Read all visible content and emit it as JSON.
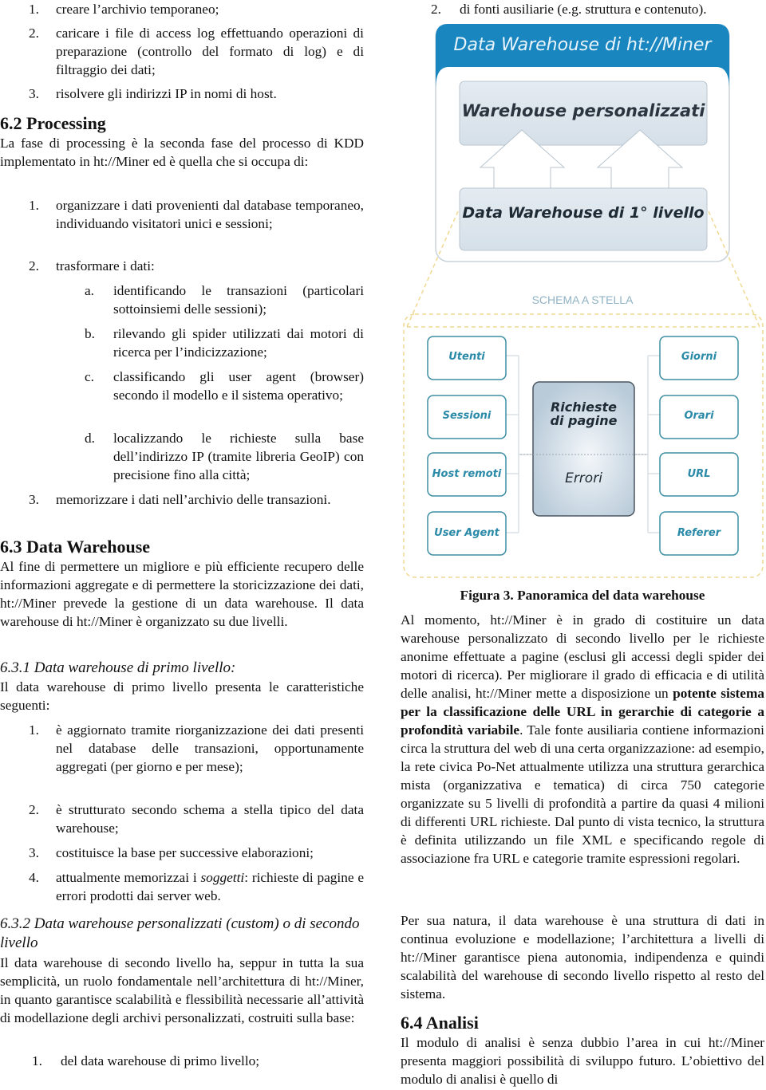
{
  "left_column": {
    "intro_list": [
      {
        "num": "1.",
        "text": "creare l’archivio temporaneo;"
      },
      {
        "num": "2.",
        "text": "caricare i file di access log effettuando operazioni di preparazione (controllo del formato di log) e di filtraggio dei dati;"
      },
      {
        "num": "3.",
        "text": "risolvere gli indirizzi IP in nomi di host."
      }
    ],
    "section_6_2": {
      "heading": "6.2  Processing",
      "paragraph": "La fase di processing è la seconda fase del processo di KDD implementato in ht://Miner ed è quella che si occupa di:",
      "list": [
        {
          "num": "1.",
          "text": "organizzare i dati provenienti dal database temporaneo, individuando visitatori unici e sessioni;"
        },
        {
          "num": "2.",
          "text": "trasformare i dati:"
        },
        {
          "num": "3.",
          "text": "memorizzare i dati nell’archivio delle transazioni."
        }
      ],
      "sublist": [
        {
          "num": "a.",
          "text": "identificando le transazioni (particolari sottoinsiemi delle sessioni);"
        },
        {
          "num": "b.",
          "text": "rilevando gli spider utilizzati dai motori di ricerca per l’indicizzazione;"
        },
        {
          "num": "c.",
          "text": "classificando gli user agent (browser) secondo il modello e il sistema operativo;"
        },
        {
          "num": "d.",
          "text": "localizzando le richieste sulla base dell’indirizzo IP (tramite libreria GeoIP) con precisione fino alla città;"
        }
      ]
    },
    "section_6_3": {
      "heading": "6.3  Data Warehouse",
      "paragraph": "Al fine di permettere un migliore e più efficiente recupero delle informazioni aggregate e di permettere la storicizzazione dei dati, ht://Miner prevede la gestione di un data warehouse. Il data warehouse di ht://Miner è organizzato su due livelli."
    },
    "section_6_3_1": {
      "heading": "6.3.1  Data warehouse di primo livello:",
      "paragraph": "Il data warehouse di primo livello presenta le caratteristiche seguenti:",
      "list": [
        {
          "num": "1.",
          "text": "è aggiornato tramite riorganizzazione dei dati presenti nel database delle transazioni, opportunamente aggregati (per giorno e per mese);"
        },
        {
          "num": "2.",
          "text": "è strutturato secondo schema a stella tipico del data warehouse;"
        },
        {
          "num": "3.",
          "text": "costituisce la base per successive elaborazioni;"
        },
        {
          "num": "4.",
          "text_before": "attualmente memorizzai i ",
          "text_italic": "soggetti",
          "text_after": ": richieste di pagine e errori prodotti dai server web."
        }
      ]
    },
    "section_6_3_2": {
      "heading": "6.3.2  Data warehouse personalizzati (custom) o di secondo livello",
      "paragraph": "Il data warehouse di secondo livello ha, seppur in tutta la sua semplicità, un ruolo fondamentale nell’architettura di ht://Miner, in quanto garantisce scalabilità e flessibilità necessarie all’attività di modellazione degli archivi personalizzati, costruiti sulla base:",
      "list": [
        {
          "num": "1.",
          "text": "del data warehouse di primo livello;"
        }
      ]
    }
  },
  "right_column": {
    "list_continued": [
      {
        "num": "2.",
        "text": "di fonti ausiliarie (e.g. struttura e contenuto)."
      }
    ],
    "figure": {
      "title": "Data Warehouse di ht://Miner",
      "top_box": "Warehouse personalizzati",
      "bottom_box": "Data Warehouse di 1° livello",
      "schema_label": "SCHEMA A STELLA",
      "left_dimensions": [
        "Utenti",
        "Sessioni",
        "Host remoti",
        "User Agent"
      ],
      "right_dimensions": [
        "Giorni",
        "Orari",
        "URL",
        "Referer"
      ],
      "fact_top": "Richieste di pagine",
      "fact_top_line1": "Richieste",
      "fact_top_line2": "di pagine",
      "fact_bottom": "Errori",
      "colors": {
        "header_blue": "#1a86c0",
        "dimension_text": "#2a8aa8",
        "box_fill": "#dde6ee",
        "dashed_border": "#f0d890"
      }
    },
    "caption": "Figura 3. Panoramica del data warehouse",
    "paragraph_1": {
      "before": "Al momento, ht://Miner è in grado di costituire un data warehouse personalizzato di secondo livello per le richieste anonime effettuate a pagine (esclusi gli accessi degli spider dei motori di ricerca). Per migliorare il grado di efficacia e di utilità delle analisi, ht://Miner mette a disposizione un ",
      "bold": "potente sistema per la classificazione delle URL in gerarchie di categorie a profondità variabile",
      "after": ". Tale fonte ausiliaria contiene informazioni circa la struttura del web di una certa organizzazione:  ad esempio, la rete civica Po-Net attualmente utilizza una struttura gerarchica mista (organizzativa e tematica) di circa 750 categorie organizzate su 5 livelli di profondità a partire da quasi 4 milioni di differenti URL richieste. Dal punto di vista tecnico, la struttura è definita utilizzando un file XML e specificando regole di associazione fra URL e categorie tramite espressioni regolari."
    },
    "paragraph_2": "Per sua natura, il data warehouse è una struttura di dati in continua evoluzione e modellazione; l’architettura a livelli di ht://Miner garantisce piena autonomia, indipendenza e quindi scalabilità del warehouse di secondo livello rispetto al resto del sistema.",
    "section_6_4": {
      "heading": "6.4  Analisi",
      "paragraph": "Il modulo di analisi è senza dubbio l’area in cui ht://Miner presenta maggiori possibilità di sviluppo futuro. L’obiettivo del modulo di analisi è quello di"
    }
  }
}
